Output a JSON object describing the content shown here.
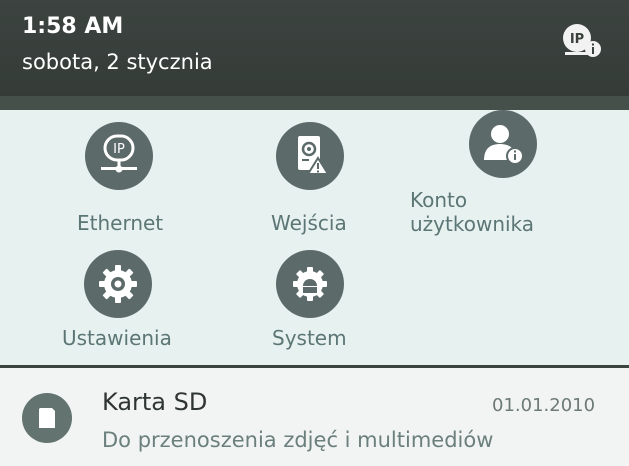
{
  "status_bar": {
    "time": "1:58 AM",
    "date": "sobota, 2 stycznia",
    "status_icon": "ip-info-icon",
    "status_icon_text": "IP"
  },
  "quick_settings": {
    "tiles": [
      {
        "label": "Ethernet",
        "icon": "ethernet-ip-icon",
        "icon_text": "IP"
      },
      {
        "label": "Wejścia",
        "icon": "inputs-alert-icon"
      },
      {
        "label": "Konto\nużytkownika",
        "icon": "user-account-icon"
      },
      {
        "label": "Ustawienia",
        "icon": "settings-gear-icon"
      },
      {
        "label": "System",
        "icon": "system-android-icon"
      }
    ]
  },
  "notification": {
    "title": "Karta SD",
    "date": "01.01.2010",
    "description": "Do przenoszenia zdjęć i multimediów",
    "icon": "sd-card-icon"
  },
  "colors": {
    "status_bar": "#3c4340",
    "panel_bg": "#e7f1f0",
    "icon_circle": "#5c6a69",
    "label_text": "#5c7675"
  }
}
